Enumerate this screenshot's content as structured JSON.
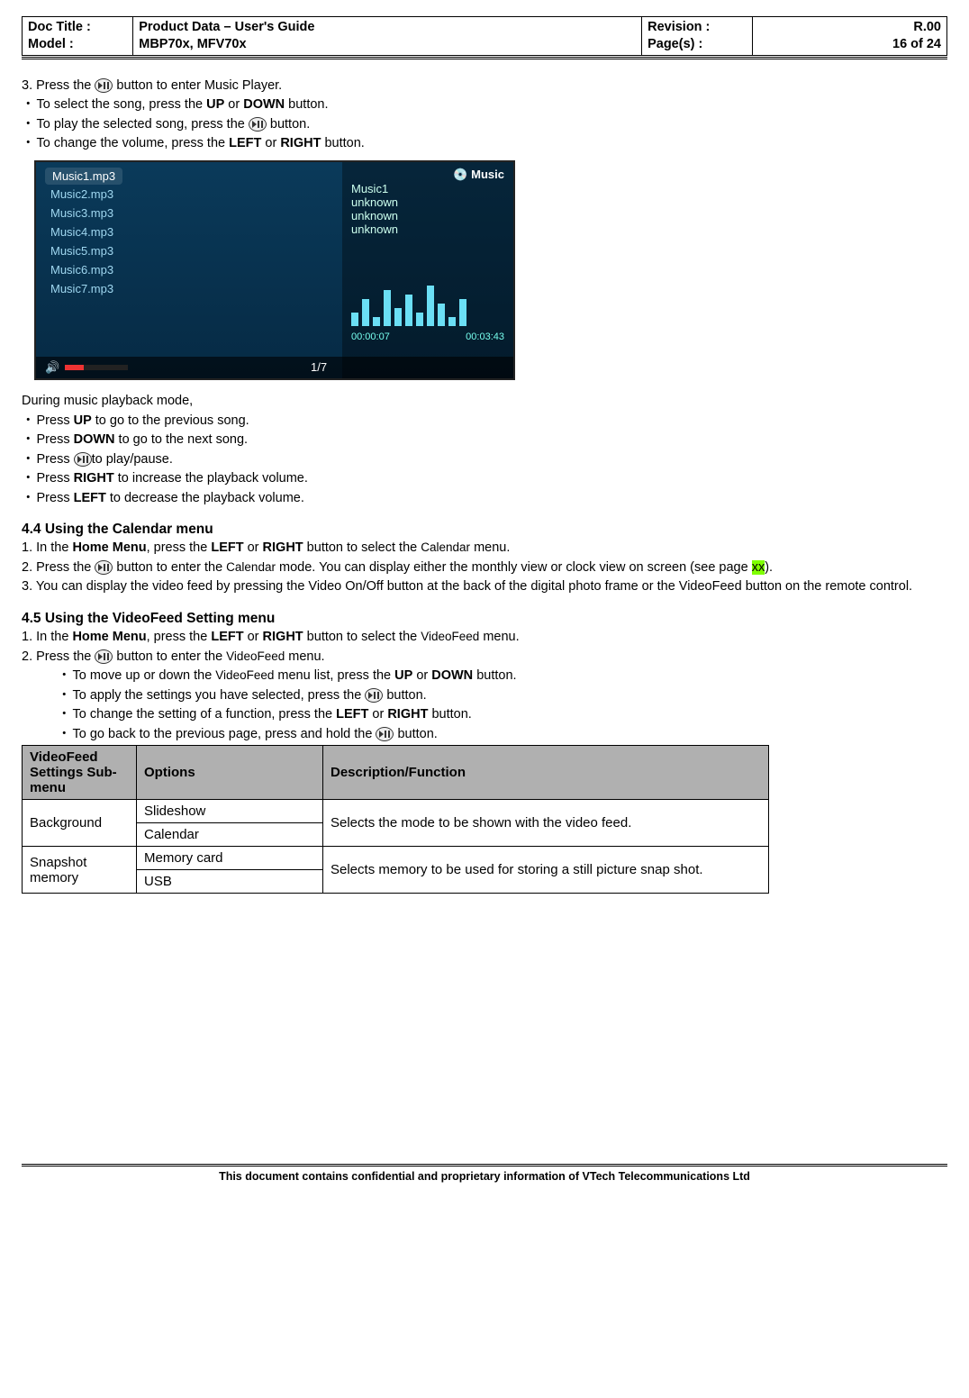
{
  "header": {
    "docTitleLabel": "Doc Title    :",
    "modelLabel": "Model         :",
    "title": "Product Data – User's Guide",
    "model": "MBP70x, MFV70x",
    "revLabel": "Revision :",
    "pageLabel": "Page(s)   :",
    "rev": "R.00",
    "page": "16 of 24"
  },
  "sec3": {
    "step3a": "3.  Press the ",
    "step3b": " button to enter Music Player.",
    "b1_pre": "To select the song, press the ",
    "b1_up": "UP",
    "b1_or": " or ",
    "b1_down": "DOWN",
    "b1_post": " button.",
    "b2_pre": "To play the selected song, press the ",
    "b2_post": " button.",
    "b3_pre": "To change the volume, press the ",
    "b3_left": "LEFT",
    "b3_or": " or ",
    "b3_right": "RIGHT",
    "b3_post": " button."
  },
  "screenshot": {
    "songs": [
      "Music1.mp3",
      "Music2.mp3",
      "Music3.mp3",
      "Music4.mp3",
      "Music5.mp3",
      "Music6.mp3",
      "Music7.mp3"
    ],
    "panelTitle": "Music",
    "track": "Music1",
    "unk": "unknown",
    "cur": "00:00:07",
    "total": "00:03:43",
    "page": "1/7"
  },
  "during": {
    "title": "During music playback mode,",
    "i1pre": "Press ",
    "i1b": "UP",
    "i1post": " to go to the previous song.",
    "i2pre": "Press ",
    "i2b": "DOWN",
    "i2post": " to go to the next song.",
    "i3pre": "Press ",
    "i3post": "to play/pause.",
    "i4pre": "Press ",
    "i4b": "RIGHT",
    "i4post": " to increase the playback volume.",
    "i5pre": "Press ",
    "i5b": "LEFT",
    "i5post": " to decrease the playback volume."
  },
  "s44": {
    "heading": "4.4     Using the Calendar menu",
    "l1a": "1.  In the ",
    "l1b": "Home Menu",
    "l1c": ", press the ",
    "l1d": "LEFT",
    "l1e": " or ",
    "l1f": "RIGHT",
    "l1g": " button to select the ",
    "l1h": "Calendar",
    "l1i": " menu.",
    "l2a": "2.  Press the ",
    "l2b": " button to enter the ",
    "l2c": "Calendar",
    "l2d": " mode. You can display either the monthly view or clock view on screen (see page ",
    "l2e": "xx",
    "l2f": ").",
    "l3": "3.  You can display the video feed by pressing the Video On/Off button at the back of the digital photo frame or the VideoFeed button on the remote control."
  },
  "s45": {
    "heading": "4.5     Using the VideoFeed Setting menu",
    "l1a": "1.   In the ",
    "l1b": "Home Menu",
    "l1c": ", press the ",
    "l1d": "LEFT",
    "l1e": " or ",
    "l1f": "RIGHT",
    "l1g": " button to select the ",
    "l1h": "VideoFeed",
    "l1i": " menu.",
    "l2a": "2.   Press the ",
    "l2b": " button to enter the ",
    "l2c": "VideoFeed",
    "l2d": " menu.",
    "b1a": "To move up or down the ",
    "b1b": "VideoFeed",
    "b1c": " menu list, press the ",
    "b1d": "UP",
    "b1e": " or ",
    "b1f": "DOWN",
    "b1g": " button.",
    "b2a": "To apply the settings you have selected, press the ",
    "b2b": " button.",
    "b3a": "To change the setting of a function, press the ",
    "b3b": "LEFT",
    "b3c": " or ",
    "b3d": "RIGHT",
    "b3e": " button.",
    "b4a": "To go back to the previous page, press and hold the ",
    "b4b": " button."
  },
  "table": {
    "h1": "VideoFeed Settings Sub-menu",
    "h2": "Options",
    "h3": "Description/Function",
    "r1c1": "Background",
    "r1o1": "Slideshow",
    "r1o2": "Calendar",
    "r1d": "Selects the mode to be shown with the video feed.",
    "r2c1": "Snapshot memory",
    "r2o1": "Memory card",
    "r2o2": "USB",
    "r2d": "Selects memory to be used for storing a still picture snap shot."
  },
  "footer": "This document contains confidential and proprietary information of VTech Telecommunications Ltd"
}
